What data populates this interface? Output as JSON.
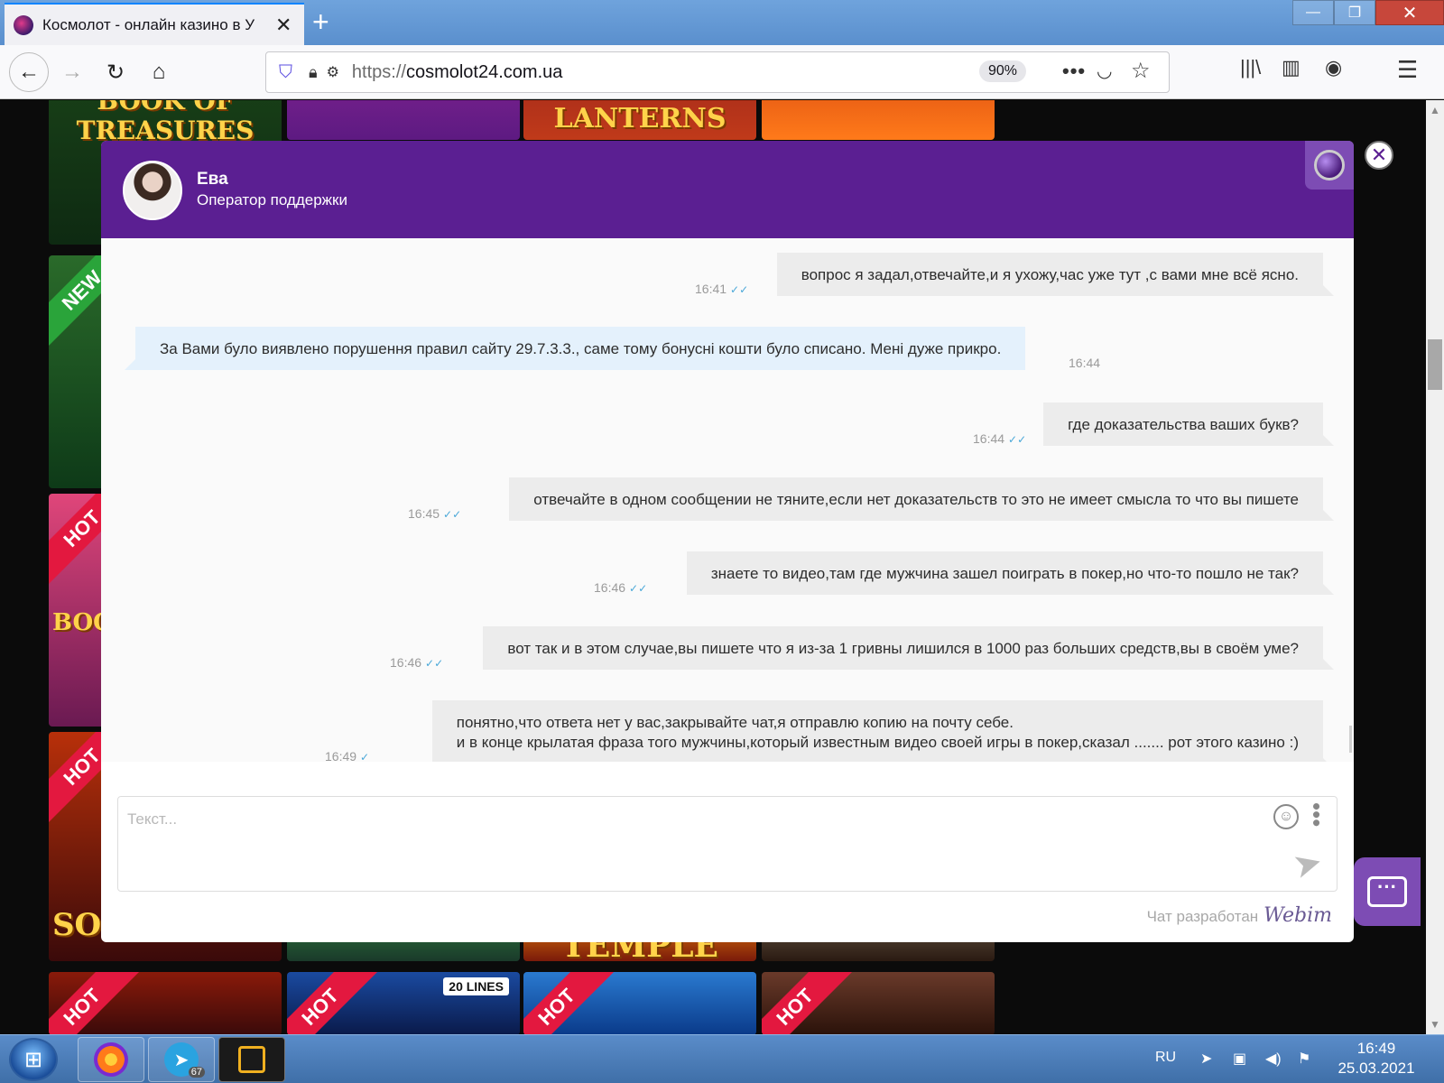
{
  "browser": {
    "tab_title": "Космолот - онлайн казино в У",
    "url_scheme": "https://",
    "url_host": "cosmolot24.com.ua",
    "zoom": "90%"
  },
  "tiles": {
    "book": "BOOK OF TREASURES",
    "lanterns": "LANTERNS",
    "solar": "SOLAR KING",
    "temple": "TEMPLE",
    "lines": "20 LINES",
    "boo": "BOO"
  },
  "ribbons": {
    "new": "NEW",
    "hot": "HOT"
  },
  "chat": {
    "operator_name": "Ева",
    "operator_role": "Оператор поддержки",
    "messages": [
      {
        "dir": "out",
        "text": "вопрос я задал,отвечайте,и я ухожу,час уже тут ,с вами мне всё ясно.",
        "time": "16:41"
      },
      {
        "dir": "in",
        "text": "За Вами було виявлено порушення правил сайту 29.7.3.3., саме тому бонусні кошти було списано. Мені дуже прикро.",
        "time": "16:44"
      },
      {
        "dir": "out",
        "text": "где доказательства ваших букв?",
        "time": "16:44"
      },
      {
        "dir": "out",
        "text": "отвечайте в одном сообщении не тяните,если нет доказательств то это не имеет смысла то что вы пишете",
        "time": "16:45"
      },
      {
        "dir": "out",
        "text": "знаете то видео,там где мужчина зашел поиграть в покер,но что-то пошло не так?",
        "time": "16:46"
      },
      {
        "dir": "out",
        "text": "вот так и в этом случае,вы пишете что я из-за 1 гривны лишился в 1000 раз больших средств,вы в своём уме?",
        "time": "16:46"
      },
      {
        "dir": "out",
        "text": "понятно,что ответа нет у вас,закрывайте чат,я отправлю копию на почту себе.\nи в конце крылатая фраза того мужчины,который известным видео своей игры в покер,сказал ....... рот этого казино :)",
        "time": "16:49"
      }
    ],
    "input_placeholder": "Текст...",
    "powered_by": "Чат разработан",
    "powered_brand": "Webim"
  },
  "taskbar": {
    "telegram_badge": "67",
    "lang": "RU",
    "time": "16:49",
    "date": "25.03.2021"
  }
}
